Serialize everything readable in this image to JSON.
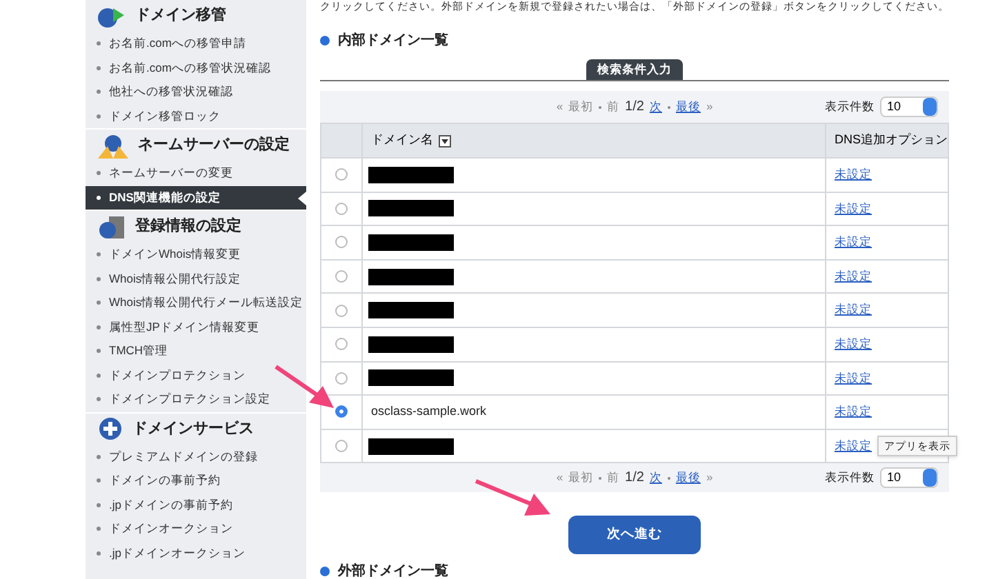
{
  "sidebar": {
    "sections": [
      {
        "title": "ドメイン移管",
        "items": [
          {
            "label": "お名前.comへの移管申請",
            "selected": false
          },
          {
            "label": "お名前.comへの移管状況確認",
            "selected": false
          },
          {
            "label": "他社への移管状況確認",
            "selected": false
          },
          {
            "label": "ドメイン移管ロック",
            "selected": false
          }
        ]
      },
      {
        "title": "ネームサーバーの設定",
        "items": [
          {
            "label": "ネームサーバーの変更",
            "selected": false
          },
          {
            "label": "DNS関連機能の設定",
            "selected": true
          }
        ]
      },
      {
        "title": "登録情報の設定",
        "items": [
          {
            "label": "ドメインWhois情報変更",
            "selected": false
          },
          {
            "label": "Whois情報公開代行設定",
            "selected": false
          },
          {
            "label": "Whois情報公開代行メール転送設定",
            "selected": false
          },
          {
            "label": "属性型JPドメイン情報変更",
            "selected": false
          },
          {
            "label": "TMCH管理",
            "selected": false
          },
          {
            "label": "ドメインプロテクション",
            "selected": false
          },
          {
            "label": "ドメインプロテクション設定",
            "selected": false
          }
        ]
      },
      {
        "title": "ドメインサービス",
        "items": [
          {
            "label": "プレミアムドメインの登録",
            "selected": false
          },
          {
            "label": "ドメインの事前予約",
            "selected": false
          },
          {
            "label": ".jpドメインの事前予約",
            "selected": false
          },
          {
            "label": "ドメインオークション",
            "selected": false
          },
          {
            "label": ".jpドメインオークション",
            "selected": false
          }
        ]
      }
    ]
  },
  "intro": "クリックしてください。外部ドメインを新規で登録されたい場合は、「外部ドメインの登録」ボタンをクリックしてください。",
  "internal_heading": "内部ドメイン一覧",
  "search_tab": "検索条件入力",
  "pagination_top": {
    "start": "«",
    "end": "»",
    "links": [
      {
        "label": "最初",
        "disabled": true
      },
      {
        "label": "前",
        "disabled": true
      }
    ],
    "page": "1/2",
    "links_after": [
      {
        "label": "次",
        "disabled": false
      },
      {
        "label": "最後",
        "disabled": false
      }
    ],
    "per_page_label": "表示件数",
    "per_page": "10"
  },
  "table": {
    "columns": [
      "ドメイン名",
      "DNS追加オプション"
    ],
    "rows": [
      {
        "selected": false,
        "redacted": true,
        "dns": "未設定"
      },
      {
        "selected": false,
        "redacted": true,
        "dns": "未設定"
      },
      {
        "selected": false,
        "redacted": true,
        "dns": "未設定"
      },
      {
        "selected": false,
        "redacted": true,
        "dns": "未設定"
      },
      {
        "selected": false,
        "redacted": true,
        "dns": "未設定"
      },
      {
        "selected": false,
        "redacted": true,
        "dns": "未設定"
      },
      {
        "selected": false,
        "redacted": true,
        "dns": "未設定"
      },
      {
        "selected": true,
        "redacted": false,
        "domain": "osclass-sample.work",
        "dns": "未設定"
      },
      {
        "selected": false,
        "redacted": true,
        "dns": "未設定"
      }
    ]
  },
  "tooltip": "アプリを表示",
  "pagination_bottom": {
    "start": "«",
    "end": "»",
    "links": [
      {
        "label": "最初",
        "disabled": true
      },
      {
        "label": "前",
        "disabled": true
      }
    ],
    "page": "1/2",
    "links_after": [
      {
        "label": "次",
        "disabled": false
      },
      {
        "label": "最後",
        "disabled": false
      }
    ],
    "per_page_label": "表示件数",
    "per_page": "10"
  },
  "next_button": "次へ進む",
  "external_heading": "外部ドメイン一覧"
}
